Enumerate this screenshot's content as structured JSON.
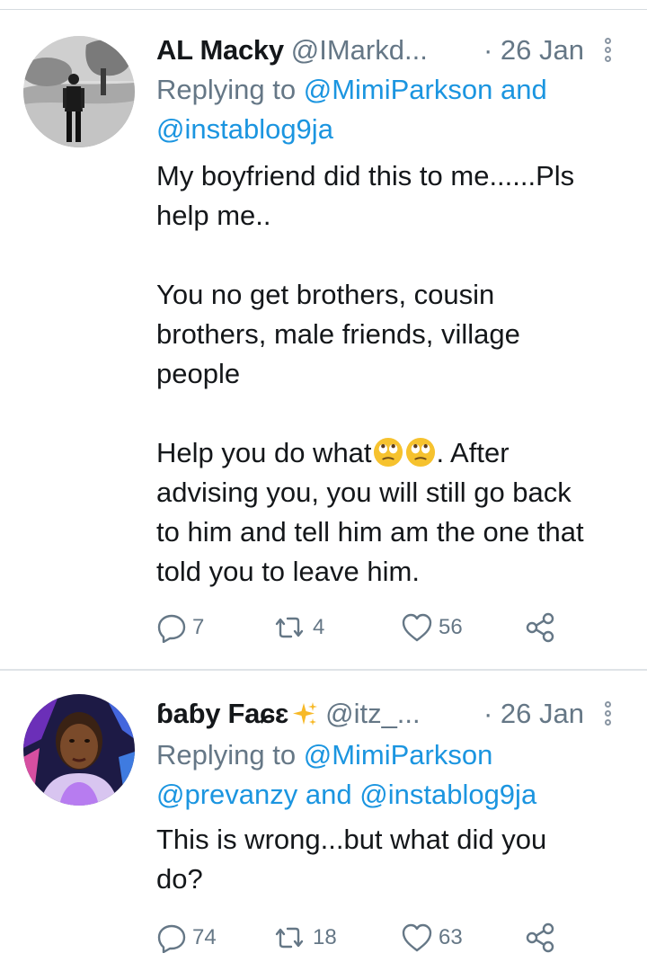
{
  "tweets": [
    {
      "name": "AL Macky",
      "handle": "@IMarkd...",
      "date": "· 26 Jan",
      "replying_prefix": "Replying to ",
      "replying_mentions": [
        "@MimiParkson",
        "and",
        "@instablog9ja"
      ],
      "text_before_emoji": "My boyfriend did this to me......Pls\nhelp me..\n\nYou no get brothers, cousin\nbrothers, male friends, village\npeople\n\nHelp you do what",
      "emoji": [
        "face-with-rolling-eyes",
        "face-with-rolling-eyes"
      ],
      "text_after_emoji": ". After\nadvising you, you will still go back\nto him and tell him am the one that\ntold you to leave him.",
      "replies": "7",
      "retweets": "4",
      "likes": "56"
    },
    {
      "name": "ɓaɓy Faɕɛ",
      "name_emoji": "sparkles",
      "handle": "@itz_...",
      "date": "· 26 Jan",
      "replying_prefix": "Replying to ",
      "replying_mentions": [
        "@MimiParkson",
        "@prevanzy",
        "and",
        "@instablog9ja"
      ],
      "text": "This is wrong...but what did you\ndo?",
      "replies": "74",
      "retweets": "18",
      "likes": "63"
    }
  ],
  "colors": {
    "text": "#14171a",
    "secondary": "#657786",
    "mention": "#1b95e0",
    "divider": "#dfe3e7"
  }
}
